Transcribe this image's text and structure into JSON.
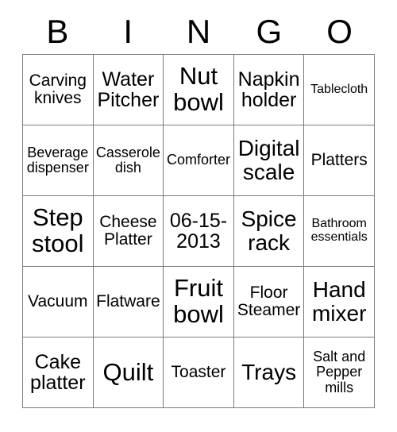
{
  "card": {
    "header_letters": [
      "B",
      "I",
      "N",
      "G",
      "O"
    ],
    "columns": [
      {
        "letter": "B",
        "cells": [
          {
            "text": "Carving\nknives",
            "size": "md"
          },
          {
            "text": "Beverage\ndispenser",
            "size": "sm"
          },
          {
            "text": "Step\nstool",
            "size": "xxl"
          },
          {
            "text": "Vacuum",
            "size": "md"
          },
          {
            "text": "Cake\nplatter",
            "size": "lg"
          }
        ]
      },
      {
        "letter": "I",
        "cells": [
          {
            "text": "Water\nPitcher",
            "size": "lg"
          },
          {
            "text": "Casserole\ndish",
            "size": "sm"
          },
          {
            "text": "Cheese\nPlatter",
            "size": "md"
          },
          {
            "text": "Flatware",
            "size": "md"
          },
          {
            "text": "Quilt",
            "size": "xxl"
          }
        ]
      },
      {
        "letter": "N",
        "cells": [
          {
            "text": "Nut\nbowl",
            "size": "xxl"
          },
          {
            "text": "Comforter",
            "size": "sm"
          },
          {
            "text": "06-15-\n2013",
            "size": "lg"
          },
          {
            "text": "Fruit\nbowl",
            "size": "xxl"
          },
          {
            "text": "Toaster",
            "size": "md"
          }
        ]
      },
      {
        "letter": "G",
        "cells": [
          {
            "text": "Napkin\nholder",
            "size": "lg"
          },
          {
            "text": "Digital\nscale",
            "size": "xl"
          },
          {
            "text": "Spice\nrack",
            "size": "xl"
          },
          {
            "text": "Floor\nSteamer",
            "size": "md"
          },
          {
            "text": "Trays",
            "size": "xl"
          }
        ]
      },
      {
        "letter": "O",
        "cells": [
          {
            "text": "Tablecloth",
            "size": "xs"
          },
          {
            "text": "Platters",
            "size": "md"
          },
          {
            "text": "Bathroom\nessentials",
            "size": "xs"
          },
          {
            "text": "Hand\nmixer",
            "size": "xl"
          },
          {
            "text": "Salt and\nPepper\nmills",
            "size": "sm"
          }
        ]
      }
    ]
  }
}
